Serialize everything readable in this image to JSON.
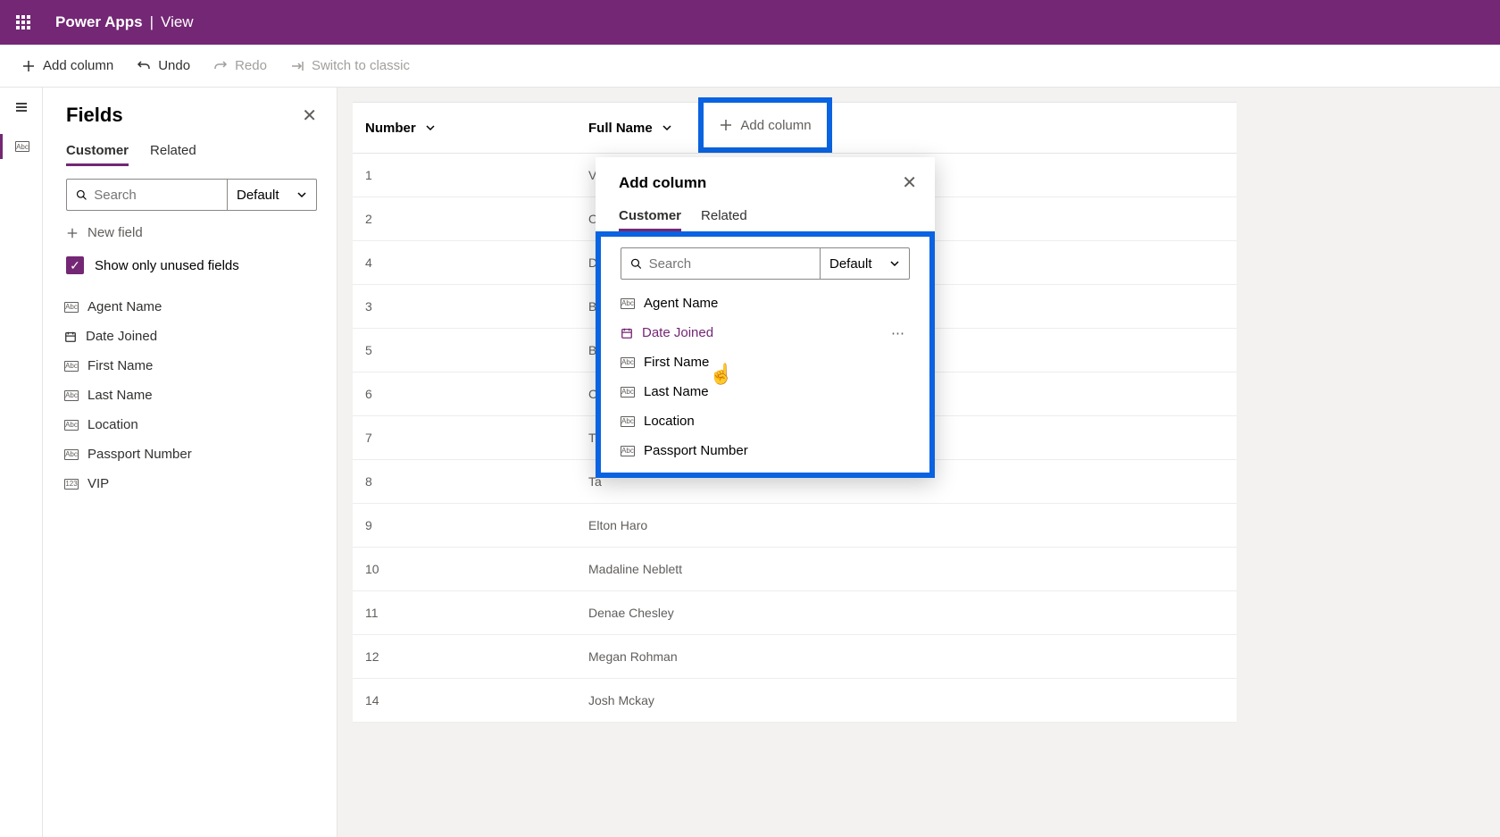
{
  "header": {
    "app": "Power Apps",
    "view": "View"
  },
  "commands": {
    "add_column": "Add column",
    "undo": "Undo",
    "redo": "Redo",
    "switch": "Switch to classic"
  },
  "fields_panel": {
    "title": "Fields",
    "tabs": {
      "customer": "Customer",
      "related": "Related"
    },
    "search_placeholder": "Search",
    "filter": "Default",
    "new_field": "New field",
    "show_unused": "Show only unused fields",
    "items": [
      {
        "label": "Agent Name",
        "type": "text"
      },
      {
        "label": "Date Joined",
        "type": "date"
      },
      {
        "label": "First Name",
        "type": "text"
      },
      {
        "label": "Last Name",
        "type": "text"
      },
      {
        "label": "Location",
        "type": "text"
      },
      {
        "label": "Passport Number",
        "type": "text"
      },
      {
        "label": "VIP",
        "type": "num"
      }
    ]
  },
  "table": {
    "columns": {
      "number": "Number",
      "full_name": "Full Name"
    },
    "add_column_btn": "Add column",
    "rows": [
      {
        "number": "1",
        "name_preview": "Vik"
      },
      {
        "number": "2",
        "name_preview": "Om"
      },
      {
        "number": "4",
        "name_preview": "D"
      },
      {
        "number": "3",
        "name_preview": "B"
      },
      {
        "number": "5",
        "name_preview": "B"
      },
      {
        "number": "6",
        "name_preview": "C"
      },
      {
        "number": "7",
        "name_preview": "T"
      },
      {
        "number": "8",
        "name_preview": "Ta"
      },
      {
        "number": "9",
        "name_preview": "Elton Haro"
      },
      {
        "number": "10",
        "name_preview": "Madaline Neblett"
      },
      {
        "number": "11",
        "name_preview": "Denae Chesley"
      },
      {
        "number": "12",
        "name_preview": "Megan Rohman"
      },
      {
        "number": "14",
        "name_preview": "Josh Mckay"
      }
    ]
  },
  "popup": {
    "title": "Add column",
    "tabs": {
      "customer": "Customer",
      "related": "Related"
    },
    "search_placeholder": "Search",
    "filter": "Default",
    "items": [
      {
        "label": "Agent Name",
        "type": "text",
        "hover": false
      },
      {
        "label": "Date Joined",
        "type": "date",
        "hover": true
      },
      {
        "label": "First Name",
        "type": "text",
        "hover": false
      },
      {
        "label": "Last Name",
        "type": "text",
        "hover": false
      },
      {
        "label": "Location",
        "type": "text",
        "hover": false
      },
      {
        "label": "Passport Number",
        "type": "text",
        "hover": false
      }
    ]
  }
}
